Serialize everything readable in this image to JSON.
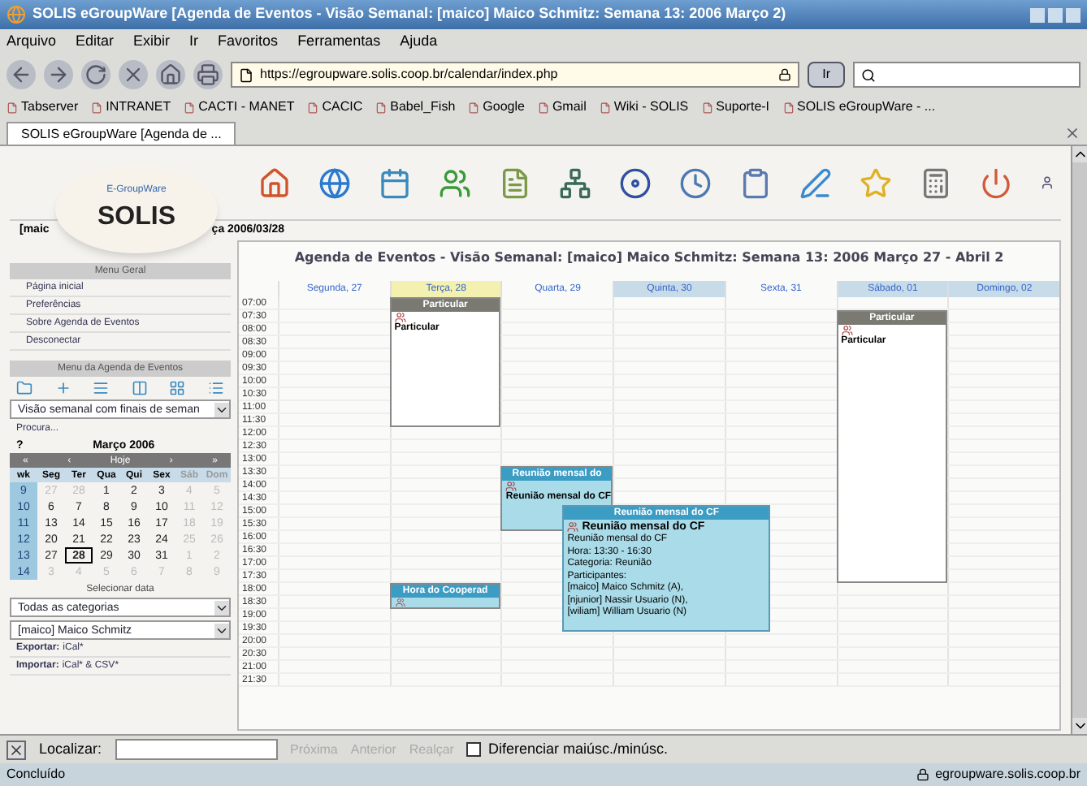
{
  "window": {
    "title": "SOLIS eGroupWare [Agenda de Eventos - Visão Semanal: [maico] Maico Schmitz: Semana 13: 2006 Março 2)"
  },
  "menu": [
    "Arquivo",
    "Editar",
    "Exibir",
    "Ir",
    "Favoritos",
    "Ferramentas",
    "Ajuda"
  ],
  "navigation": {
    "url": "https://egroupware.solis.coop.br/calendar/index.php",
    "go_button": "Ir"
  },
  "bookmarks": [
    "Tabserver",
    "INTRANET",
    "CACTI - MANET",
    "CACIC",
    "Babel_Fish",
    "Google",
    "Gmail",
    "Wiki - SOLIS",
    "Suporte-I",
    "SOLIS eGroupWare - ..."
  ],
  "tabs": [
    {
      "label": "SOLIS eGroupWare [Agenda de ...",
      "selected": true
    }
  ],
  "app": {
    "logo_caption": "E-GroupWare",
    "logo_text": "SOLIS",
    "user_fragment": "[maic",
    "date_fragment": "ça 2006/03/28"
  },
  "sidebar": {
    "general_menu": {
      "title": "Menu Geral",
      "items": [
        "Página inicial",
        "Preferências",
        "Sobre Agenda de Eventos",
        "Desconectar"
      ]
    },
    "calendar_menu": {
      "title": "Menu da Agenda de Eventos",
      "view_select": "Visão semanal com finais de seman",
      "search": "Procura...",
      "mini_calendar": {
        "help": "?",
        "month": "Março 2006",
        "nav": [
          "«",
          "‹",
          "Hoje",
          "›",
          "»"
        ],
        "headers": [
          "wk",
          "Seg",
          "Ter",
          "Qua",
          "Qui",
          "Sex",
          "Sáb",
          "Dom"
        ],
        "weeks": [
          {
            "week": "9",
            "days": [
              {
                "label": "27",
                "muted": true,
                "selected": false
              },
              {
                "label": "28",
                "muted": true,
                "selected": false
              },
              {
                "label": "1",
                "muted": false,
                "selected": false
              },
              {
                "label": "2",
                "muted": false,
                "selected": false
              },
              {
                "label": "3",
                "muted": false,
                "selected": false
              },
              {
                "label": "4",
                "muted": true,
                "selected": false
              },
              {
                "label": "5",
                "muted": true,
                "selected": false
              }
            ]
          },
          {
            "week": "10",
            "days": [
              {
                "label": "6",
                "muted": false,
                "selected": false
              },
              {
                "label": "7",
                "muted": false,
                "selected": false
              },
              {
                "label": "8",
                "muted": false,
                "selected": false
              },
              {
                "label": "9",
                "muted": false,
                "selected": false
              },
              {
                "label": "10",
                "muted": false,
                "selected": false
              },
              {
                "label": "11",
                "muted": true,
                "selected": false
              },
              {
                "label": "12",
                "muted": true,
                "selected": false
              }
            ]
          },
          {
            "week": "11",
            "days": [
              {
                "label": "13",
                "muted": false,
                "selected": false
              },
              {
                "label": "14",
                "muted": false,
                "selected": false
              },
              {
                "label": "15",
                "muted": false,
                "selected": false
              },
              {
                "label": "16",
                "muted": false,
                "selected": false
              },
              {
                "label": "17",
                "muted": false,
                "selected": false
              },
              {
                "label": "18",
                "muted": true,
                "selected": false
              },
              {
                "label": "19",
                "muted": true,
                "selected": false
              }
            ]
          },
          {
            "week": "12",
            "days": [
              {
                "label": "20",
                "muted": false,
                "selected": false
              },
              {
                "label": "21",
                "muted": false,
                "selected": false
              },
              {
                "label": "22",
                "muted": false,
                "selected": false
              },
              {
                "label": "23",
                "muted": false,
                "selected": false
              },
              {
                "label": "24",
                "muted": false,
                "selected": false
              },
              {
                "label": "25",
                "muted": true,
                "selected": false
              },
              {
                "label": "26",
                "muted": true,
                "selected": false
              }
            ]
          },
          {
            "week": "13",
            "days": [
              {
                "label": "27",
                "muted": false,
                "selected": false
              },
              {
                "label": "28",
                "muted": false,
                "selected": true
              },
              {
                "label": "29",
                "muted": false,
                "selected": false
              },
              {
                "label": "30",
                "muted": false,
                "selected": false
              },
              {
                "label": "31",
                "muted": false,
                "selected": false
              },
              {
                "label": "1",
                "muted": true,
                "selected": false
              },
              {
                "label": "2",
                "muted": true,
                "selected": false
              }
            ]
          },
          {
            "week": "14",
            "days": [
              {
                "label": "3",
                "muted": true,
                "selected": false
              },
              {
                "label": "4",
                "muted": true,
                "selected": false
              },
              {
                "label": "5",
                "muted": true,
                "selected": false
              },
              {
                "label": "6",
                "muted": true,
                "selected": false
              },
              {
                "label": "7",
                "muted": true,
                "selected": false
              },
              {
                "label": "8",
                "muted": true,
                "selected": false
              },
              {
                "label": "9",
                "muted": true,
                "selected": false
              }
            ]
          }
        ]
      },
      "select_date": "Selecionar data",
      "category_select": "Todas as categorias",
      "user_select": "[maico] Maico Schmitz",
      "links": [
        {
          "label": "Exportar:",
          "value": "iCal*"
        },
        {
          "label": "Importar:",
          "value": "iCal* & CSV*"
        }
      ]
    }
  },
  "calendar": {
    "heading": "Agenda de Eventos - Visão Semanal: [maico] Maico Schmitz: Semana 13: 2006 Março 27 - Abril 2",
    "days": [
      {
        "label": "Segunda, 27",
        "kind": "plain"
      },
      {
        "label": "Terça, 28",
        "kind": "today"
      },
      {
        "label": "Quarta, 29",
        "kind": "plain"
      },
      {
        "label": "Quinta, 30",
        "kind": "shaded"
      },
      {
        "label": "Sexta, 31",
        "kind": "plain"
      },
      {
        "label": "Sábado, 01",
        "kind": "shaded"
      },
      {
        "label": "Domingo, 02",
        "kind": "shaded"
      }
    ],
    "times": [
      "07:00",
      "07:30",
      "08:00",
      "08:30",
      "09:00",
      "09:30",
      "10:00",
      "10:30",
      "11:00",
      "11:30",
      "12:00",
      "12:30",
      "13:00",
      "13:30",
      "14:00",
      "14:30",
      "15:00",
      "15:30",
      "16:00",
      "16:30",
      "17:00",
      "17:30",
      "18:00",
      "18:30",
      "19:00",
      "19:30",
      "20:00",
      "20:30",
      "21:00",
      "21:30"
    ],
    "events": [
      {
        "kind": "private",
        "header": "Particular",
        "body": "Particular"
      },
      {
        "kind": "private",
        "header": "Particular",
        "body": "Particular"
      },
      {
        "kind": "meeting",
        "header": "Reunião mensal do",
        "body": "Reunião mensal do CF"
      },
      {
        "kind": "meeting",
        "header": "Hora do Cooperad"
      }
    ],
    "tooltip": {
      "header": "Reunião mensal do CF",
      "title": "Reunião mensal do CF",
      "lines": [
        "Reunião mensal do CF",
        "Hora: 13:30 - 16:30",
        "Categoria: Reunião",
        "Participantes:",
        "[maico] Maico Schmitz (A),",
        "[njunior] Nassir Usuario (N),",
        "[wiliam] William Usuario (N)"
      ]
    }
  },
  "find_bar": {
    "label": "Localizar:",
    "buttons": [
      {
        "label": "Próxima",
        "disabled": true
      },
      {
        "label": "Anterior",
        "disabled": true
      },
      {
        "label": "Realçar",
        "disabled": true
      }
    ],
    "match_case": {
      "label": "Diferenciar maiúsc./minúsc.",
      "checked": false
    }
  },
  "status_bar": {
    "text": "Concluído",
    "host": "egroupware.solis.coop.br"
  }
}
